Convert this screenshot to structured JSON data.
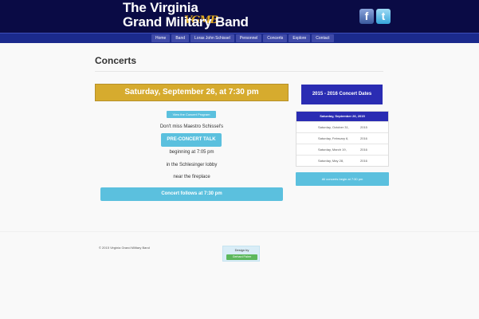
{
  "header": {
    "logo_text": "VGMB",
    "title_line1": "The Virginia",
    "title_line2": "Grand Military Band",
    "social": {
      "facebook": "f",
      "twitter": "t"
    }
  },
  "nav": {
    "items": [
      "Home",
      "Band",
      "Loras John Schissel",
      "Personnel",
      "Concerts",
      "Explore",
      "Contact"
    ]
  },
  "main": {
    "page_title": "Concerts",
    "event_banner": "Saturday, September 26, at 7:30 pm",
    "program_button": "View the Concert Program",
    "line1": "Don't miss Maestro Schissel's",
    "precon_button": "PRE-CONCERT TALK",
    "line2": "beginning at 7:05 pm",
    "line3": "in the Schlesinger lobby",
    "line4": "near the fireplace",
    "follows_button": "Concert follows at 7:30 pm"
  },
  "sidebar": {
    "dates_header": "2015 - 2016 Concert Dates",
    "active_date": "Saturday, September 26, 2015",
    "dates": [
      {
        "date": "Saturday, October 31,",
        "year": "2015"
      },
      {
        "date": "Saturday, February 6,",
        "year": "2016"
      },
      {
        "date": "Saturday, March 19,",
        "year": "2016"
      },
      {
        "date": "Saturday, May 28,",
        "year": "2016"
      }
    ],
    "note": "All concerts begin at 7:30 pm"
  },
  "footer": {
    "copyright": "© 2015 Virginia Grand Military Band",
    "design_by": "Design by",
    "designer": "Gerhard Fisher"
  },
  "colors": {
    "header_bg": "#0a0b45",
    "nav_bg": "#1b2a8c",
    "gold": "#d6ab2e",
    "accent_blue": "#5bc0de",
    "dates_blue": "#2a2cb3",
    "green": "#5cb85c"
  }
}
